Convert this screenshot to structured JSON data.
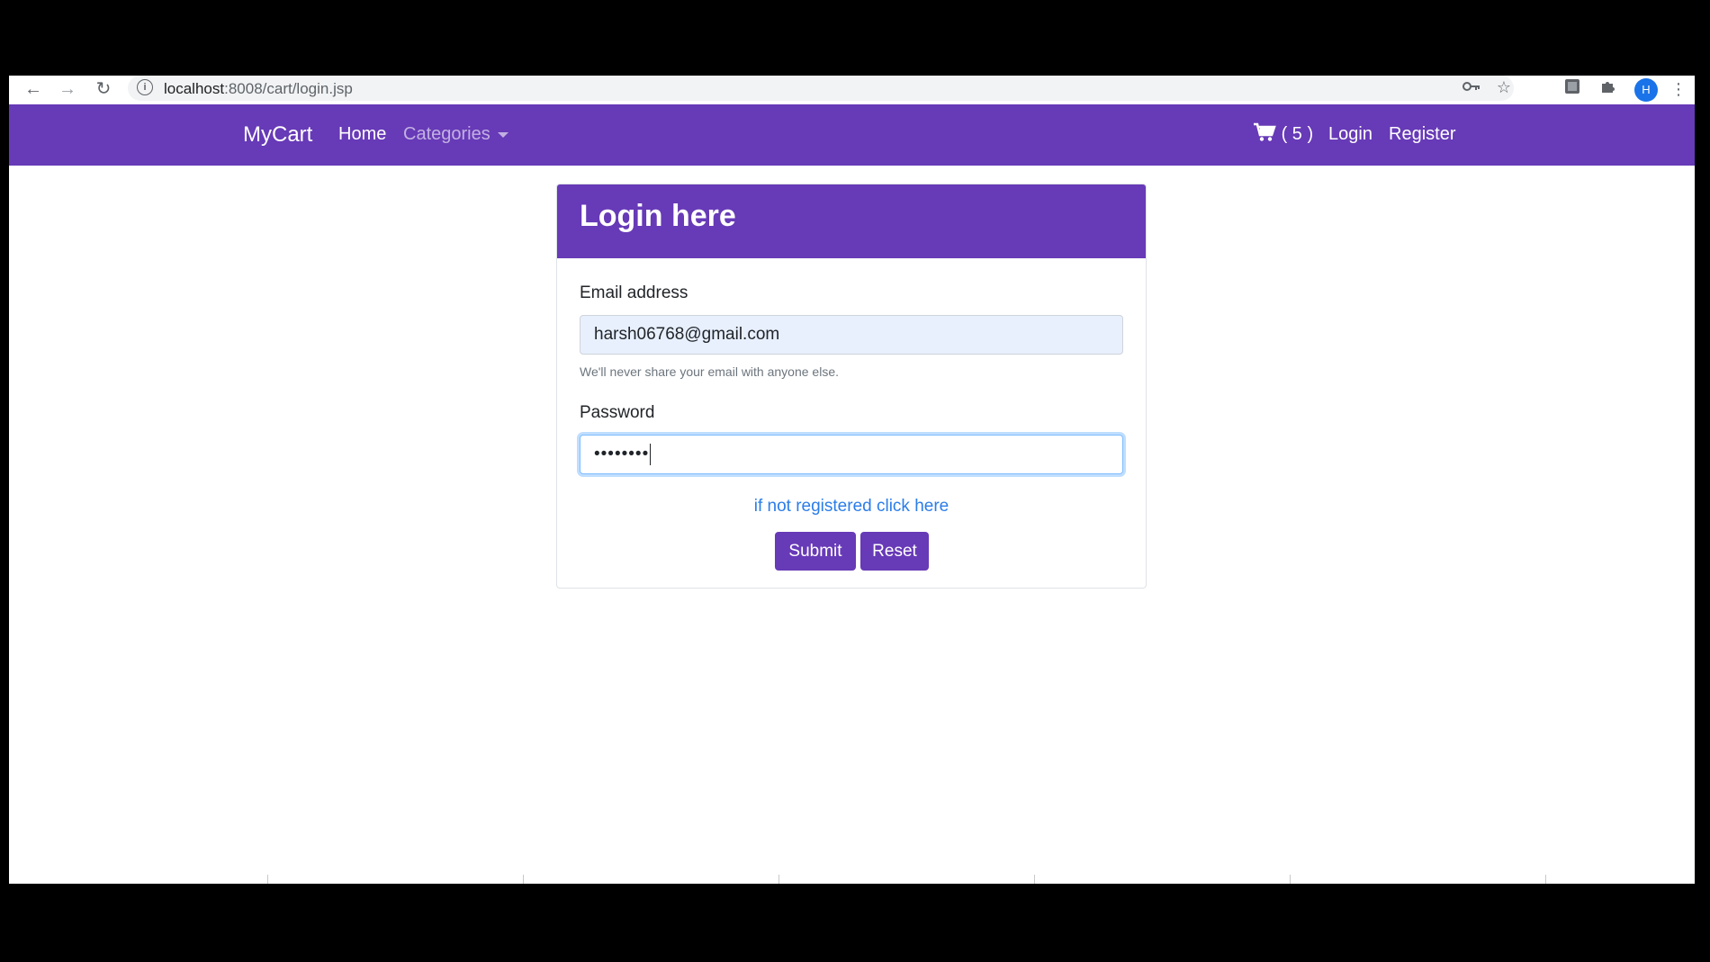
{
  "browser": {
    "url_host": "localhost",
    "url_path": ":8008/cart/login.jsp",
    "profile_initial": "H"
  },
  "navbar": {
    "brand": "MyCart",
    "home": "Home",
    "categories": "Categories",
    "cart_count": "( 5 )",
    "login": "Login",
    "register": "Register"
  },
  "login_card": {
    "title": "Login here",
    "email_label": "Email address",
    "email_value": "harsh06768@gmail.com",
    "email_help": "We'll never share your email with anyone else.",
    "password_label": "Password",
    "password_value": "••••••••",
    "register_link": "if not registered click here",
    "submit": "Submit",
    "reset": "Reset"
  },
  "colors": {
    "brand": "#673ab7",
    "link": "#2b7de9"
  }
}
